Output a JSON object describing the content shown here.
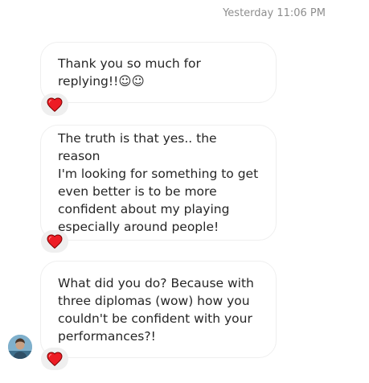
{
  "timestamp": "Yesterday 11:06 PM",
  "messages": [
    {
      "text": "Thank you so much for\nreplying!!☺☺",
      "reaction": "heart-icon"
    },
    {
      "text": "The truth is that yes.. the reason\nI'm looking for something to get\neven better is to be more\nconfident about my playing\nespecially around people!",
      "reaction": "heart-icon"
    },
    {
      "text": "What did you do? Because with\nthree diplomas (wow) how you\ncouldn't be confident with your\nperformances?!",
      "reaction": "heart-icon"
    }
  ],
  "colors": {
    "bubble_border": "#efefef",
    "text": "#262626",
    "timestamp": "#8e8e8e",
    "reaction_bg": "#efefef",
    "heart": "#ed4956"
  }
}
